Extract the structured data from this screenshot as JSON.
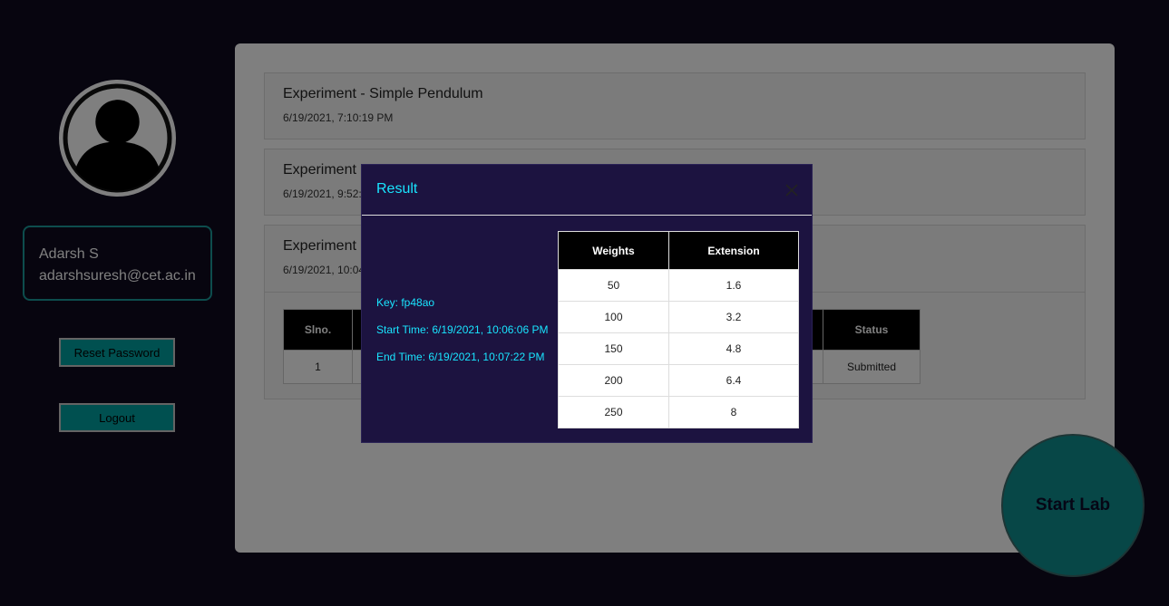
{
  "user": {
    "name": "Adarsh S",
    "email": "adarshsuresh@cet.ac.in",
    "reset_password_label": "Reset Password",
    "logout_label": "Logout"
  },
  "experiments": [
    {
      "title": "Experiment - Simple Pendulum",
      "date": "6/19/2021, 7:10:19 PM"
    },
    {
      "title": "Experiment",
      "date": "6/19/2021, 9:52:"
    },
    {
      "title": "Experiment",
      "date": "6/19/2021, 10:04"
    }
  ],
  "submission_table": {
    "headers": [
      "Slno.",
      "Status"
    ],
    "rows": [
      {
        "slno": "1",
        "status": "Submitted"
      }
    ]
  },
  "modal": {
    "title": "Result",
    "key": "Key: fp48ao",
    "start_time": "Start Time: 6/19/2021, 10:06:06 PM",
    "end_time": "End Time: 6/19/2021, 10:07:22 PM",
    "table": {
      "headers": [
        "Weights",
        "Extension"
      ],
      "rows": [
        [
          "50",
          "1.6"
        ],
        [
          "100",
          "3.2"
        ],
        [
          "150",
          "4.8"
        ],
        [
          "200",
          "6.4"
        ],
        [
          "250",
          "8"
        ]
      ]
    }
  },
  "start_lab_label": "Start Lab",
  "colors": {
    "background": "#0f0a1f",
    "accent": "#00a0a0",
    "modal_bg": "#1c1340",
    "modal_text": "#19e5ff"
  }
}
